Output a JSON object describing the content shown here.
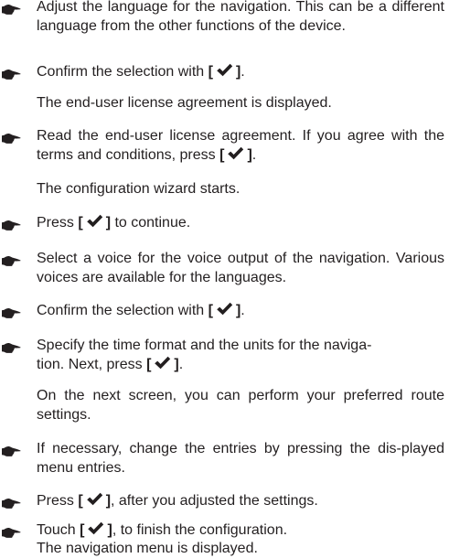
{
  "bracket_open": "[",
  "bracket_close": "]",
  "icons": {
    "bullet": "pointing-hand-icon",
    "confirm": "checkmark-icon"
  },
  "steps": [
    {
      "text": "Adjust the language for the navigation. This can be a different language from the other functions of the device."
    },
    {
      "before": "Confirm the selection with",
      "after": ".",
      "result": "The end-user license agreement is displayed."
    },
    {
      "text1": "Read the end-user license agreement. If you agree with the terms and conditions, press",
      "after": ".",
      "result": "The configuration wizard starts."
    },
    {
      "before": "Press",
      "after": "to continue."
    },
    {
      "text": "Select a voice for the voice output of the navigation. Various voices are available for the languages."
    },
    {
      "before": "Confirm the selection with",
      "after": "."
    },
    {
      "line1": "Specify the time format and the units for the naviga-",
      "line2_before": "tion. Next, press",
      "line2_after": ".",
      "result": "On the next screen, you can perform your preferred route settings."
    },
    {
      "text": "If necessary, change the entries by pressing the dis-played menu entries."
    },
    {
      "before": "Press",
      "after": ", after you adjusted the settings."
    },
    {
      "before": "Touch",
      "after": ", to finish the configuration.",
      "result": "The navigation menu is displayed."
    }
  ]
}
